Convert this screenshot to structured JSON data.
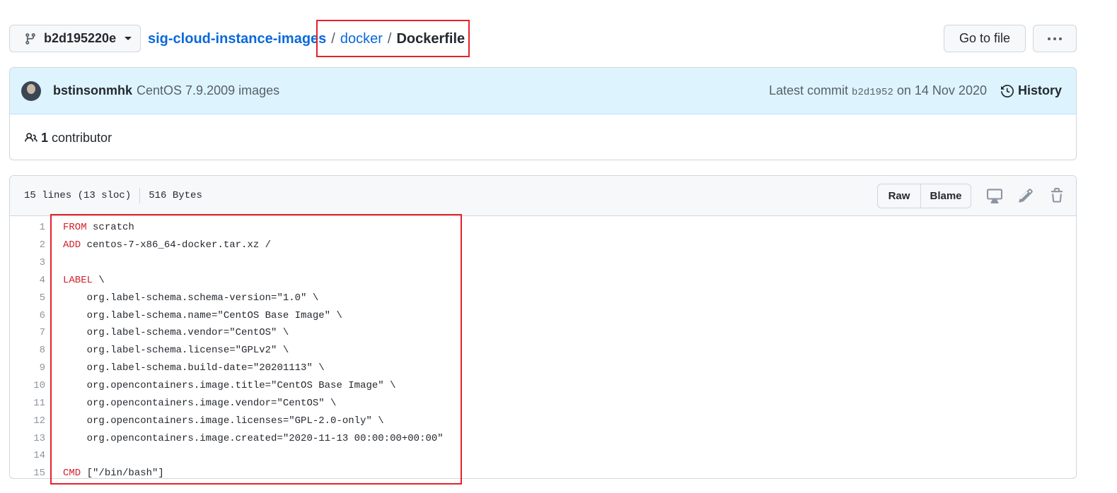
{
  "branch": {
    "name": "b2d195220e"
  },
  "breadcrumb": {
    "repo": "sig-cloud-instance-images",
    "sep1": "/",
    "dir": "docker",
    "sep2": "/",
    "file": "Dockerfile"
  },
  "actions": {
    "goto_label": "Go to file",
    "more_label": "···"
  },
  "commit": {
    "author": "bstinsonmhk",
    "message": "CentOS 7.9.2009 images",
    "latest_prefix": "Latest commit",
    "sha": "b2d1952",
    "date": "on 14 Nov 2020",
    "history_label": "History"
  },
  "contributors": {
    "count": "1",
    "label": "contributor"
  },
  "file": {
    "lines_info": "15 lines (13 sloc)",
    "size": "516 Bytes",
    "raw_label": "Raw",
    "blame_label": "Blame"
  },
  "code": [
    {
      "n": "1",
      "kw": "FROM",
      "rest": " scratch"
    },
    {
      "n": "2",
      "kw": "ADD",
      "rest": " centos-7-x86_64-docker.tar.xz /"
    },
    {
      "n": "3",
      "kw": "",
      "rest": ""
    },
    {
      "n": "4",
      "kw": "LABEL",
      "rest": " \\"
    },
    {
      "n": "5",
      "kw": "",
      "rest": "    org.label-schema.schema-version=\"1.0\" \\"
    },
    {
      "n": "6",
      "kw": "",
      "rest": "    org.label-schema.name=\"CentOS Base Image\" \\"
    },
    {
      "n": "7",
      "kw": "",
      "rest": "    org.label-schema.vendor=\"CentOS\" \\"
    },
    {
      "n": "8",
      "kw": "",
      "rest": "    org.label-schema.license=\"GPLv2\" \\"
    },
    {
      "n": "9",
      "kw": "",
      "rest": "    org.label-schema.build-date=\"20201113\" \\"
    },
    {
      "n": "10",
      "kw": "",
      "rest": "    org.opencontainers.image.title=\"CentOS Base Image\" \\"
    },
    {
      "n": "11",
      "kw": "",
      "rest": "    org.opencontainers.image.vendor=\"CentOS\" \\"
    },
    {
      "n": "12",
      "kw": "",
      "rest": "    org.opencontainers.image.licenses=\"GPL-2.0-only\" \\"
    },
    {
      "n": "13",
      "kw": "",
      "rest": "    org.opencontainers.image.created=\"2020-11-13 00:00:00+00:00\""
    },
    {
      "n": "14",
      "kw": "",
      "rest": ""
    },
    {
      "n": "15",
      "kw": "CMD",
      "rest": " [\"/bin/bash\"]"
    }
  ],
  "colors": {
    "highlight_box": "#e5212b",
    "link": "#0969da",
    "keyword": "#cf222e",
    "commit_bg": "#ddf4ff"
  }
}
